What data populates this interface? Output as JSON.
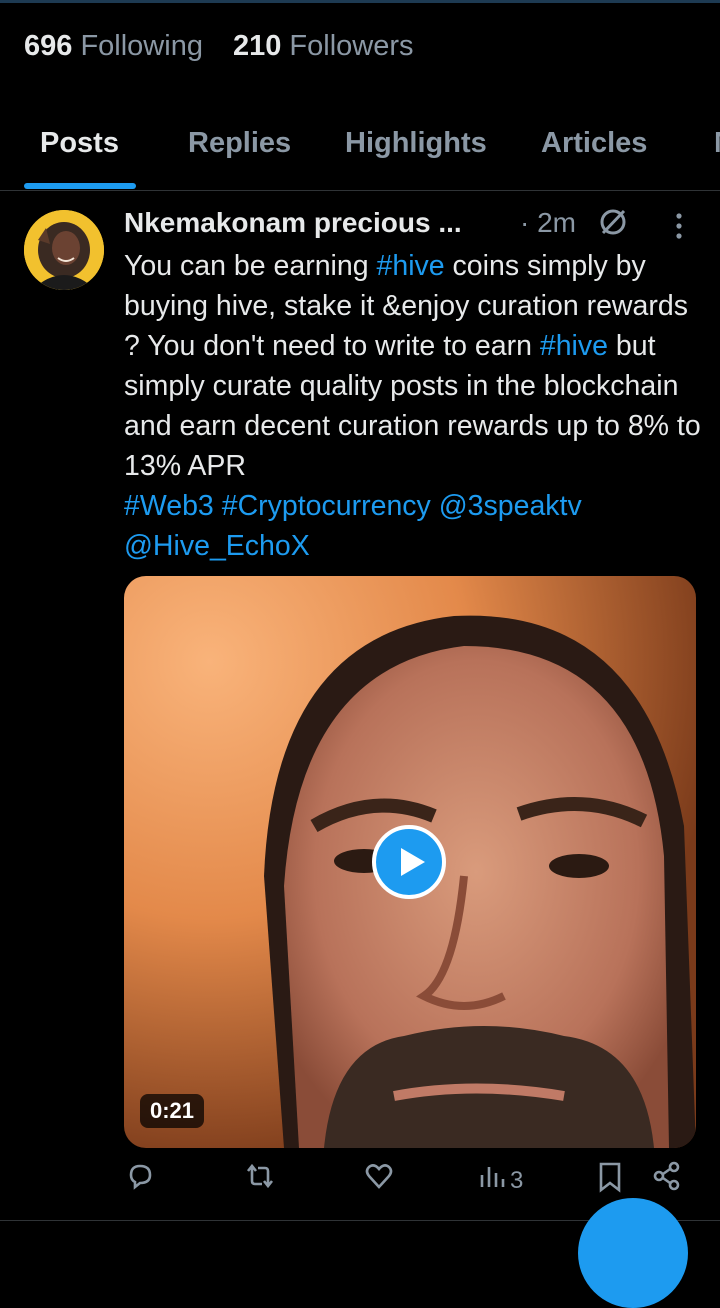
{
  "profile": {
    "following_count": "696",
    "following_label": "Following",
    "followers_count": "210",
    "followers_label": "Followers"
  },
  "tabs": [
    {
      "label": "Posts",
      "active": true
    },
    {
      "label": "Replies",
      "active": false
    },
    {
      "label": "Highlights",
      "active": false
    },
    {
      "label": "Articles",
      "active": false
    }
  ],
  "post": {
    "author": "Nkemakonam precious ...",
    "time": "· 2m",
    "text_parts": [
      "You can be earning ",
      "#hive",
      " coins simply by buying hive, stake it &enjoy curation rewards ? You don't need to write to earn ",
      "#hive",
      " but simply curate quality posts in the blockchain and earn decent curation rewards up to 8% to 13% APR",
      "#Web3",
      "#Cryptocurrency",
      "@3speaktv",
      "@Hive_EchoX"
    ],
    "video_duration": "0:21",
    "views": "3"
  },
  "icons": {
    "badge": "circle-slash-icon",
    "more": "more-vertical-icon",
    "play": "play-icon",
    "reply": "reply-icon",
    "repost": "repost-icon",
    "like": "heart-icon",
    "views": "analytics-icon",
    "bookmark": "bookmark-icon",
    "share": "share-icon"
  },
  "colors": {
    "accent": "#1d9bf0",
    "background": "#000000",
    "text": "#e7e9ea",
    "muted": "#8b98a5"
  }
}
